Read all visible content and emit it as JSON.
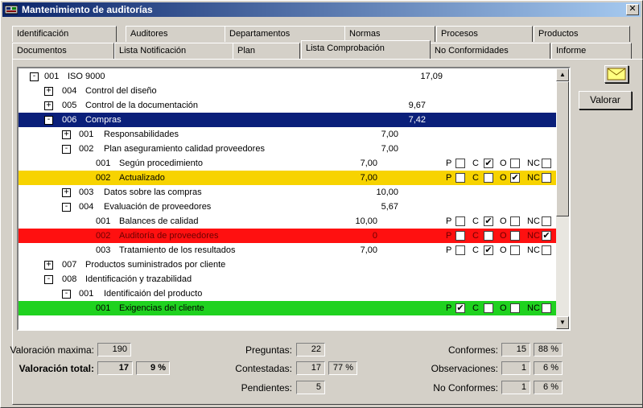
{
  "window": {
    "title": "Mantenimiento de auditorías"
  },
  "tabs_row1": [
    "Identificación",
    "Auditores",
    "Departamentos",
    "Normas",
    "Procesos",
    "Productos"
  ],
  "tabs_row2": [
    "Documentos",
    "Lista Notificación",
    "Plan",
    "Lista Comprobación",
    "No Conformidades",
    "Informe"
  ],
  "active_tab": "Lista Comprobación",
  "buttons": {
    "valorar": "Valorar",
    "mail_icon": "envelope-icon"
  },
  "tree_rows": [
    {
      "expander": "-",
      "code": "001",
      "label": "ISO 9000",
      "score": "17,09"
    },
    {
      "expander": "+",
      "code": "004",
      "label": "Control del diseño",
      "score": ""
    },
    {
      "expander": "+",
      "code": "005",
      "label": "Control de la documentación",
      "score": "9,67"
    },
    {
      "expander": "-",
      "code": "006",
      "label": "Compras",
      "score": "7,42",
      "state": "selected"
    },
    {
      "expander": "+",
      "code": "001",
      "label": "Responsabilidades",
      "score": "7,00"
    },
    {
      "expander": "-",
      "code": "002",
      "label": "Plan aseguramiento calidad proveedores",
      "score": "7,00"
    },
    {
      "expander": "",
      "code": "001",
      "label": "Según procedimiento",
      "score": "7,00",
      "checks": {
        "P": false,
        "C": true,
        "O": false,
        "NC": false
      }
    },
    {
      "expander": "",
      "code": "002",
      "label": "Actualizado",
      "score": "7,00",
      "state": "yellow",
      "checks": {
        "P": false,
        "C": false,
        "O": true,
        "NC": false
      }
    },
    {
      "expander": "+",
      "code": "003",
      "label": "Datos sobre las compras",
      "score": "10,00"
    },
    {
      "expander": "-",
      "code": "004",
      "label": "Evaluación de proveedores",
      "score": "5,67"
    },
    {
      "expander": "",
      "code": "001",
      "label": "Balances de calidad",
      "score": "10,00",
      "checks": {
        "P": false,
        "C": true,
        "O": false,
        "NC": false
      }
    },
    {
      "expander": "",
      "code": "002",
      "label": "Auditoría de proveedores",
      "score": "0",
      "state": "red",
      "checks": {
        "P": false,
        "C": false,
        "O": false,
        "NC": true
      }
    },
    {
      "expander": "",
      "code": "003",
      "label": "Tratamiento de los resultados",
      "score": "7,00",
      "checks": {
        "P": false,
        "C": true,
        "O": false,
        "NC": false
      }
    },
    {
      "expander": "+",
      "code": "007",
      "label": "Productos suministrados por cliente",
      "score": ""
    },
    {
      "expander": "-",
      "code": "008",
      "label": "Identificación y trazabilidad",
      "score": ""
    },
    {
      "expander": "-",
      "code": "001",
      "label": "Identificaión del producto",
      "score": ""
    },
    {
      "expander": "",
      "code": "001",
      "label": "Exigencias del cliente",
      "score": "",
      "state": "green",
      "checks": {
        "P": true,
        "C": false,
        "O": false,
        "NC": false
      }
    }
  ],
  "check_labels": {
    "P": "P",
    "C": "C",
    "O": "O",
    "NC": "NC"
  },
  "stats": {
    "valoracion_maxima_label": "Valoración maxima:",
    "valoracion_maxima": "190",
    "valoracion_total_label": "Valoración total:",
    "valoracion_total": "17",
    "valoracion_total_pct": "9 %",
    "preguntas_label": "Preguntas:",
    "preguntas": "22",
    "contestadas_label": "Contestadas:",
    "contestadas": "17",
    "contestadas_pct": "77 %",
    "pendientes_label": "Pendientes:",
    "pendientes": "5",
    "conformes_label": "Conformes:",
    "conformes": "15",
    "conformes_pct": "88 %",
    "observaciones_label": "Observaciones:",
    "observaciones": "1",
    "observaciones_pct": "6 %",
    "no_conformes_label": "No Conformes:",
    "no_conformes": "1",
    "no_conformes_pct": "6 %"
  }
}
